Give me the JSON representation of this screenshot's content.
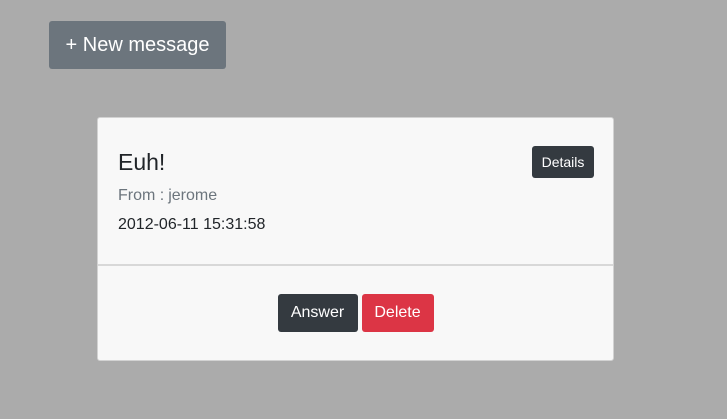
{
  "toolbar": {
    "new_message_label": "+ New message"
  },
  "message": {
    "title": "Euh!",
    "from_label": "From :",
    "sender": "jerome",
    "date": "2012-06-11 15:31:58",
    "details_label": "Details",
    "answer_label": "Answer",
    "delete_label": "Delete"
  },
  "colors": {
    "background": "#ababab",
    "secondary_button": "#6c757d",
    "dark_button": "#343a40",
    "danger_button": "#dc3545",
    "card_background": "#f8f8f8"
  }
}
